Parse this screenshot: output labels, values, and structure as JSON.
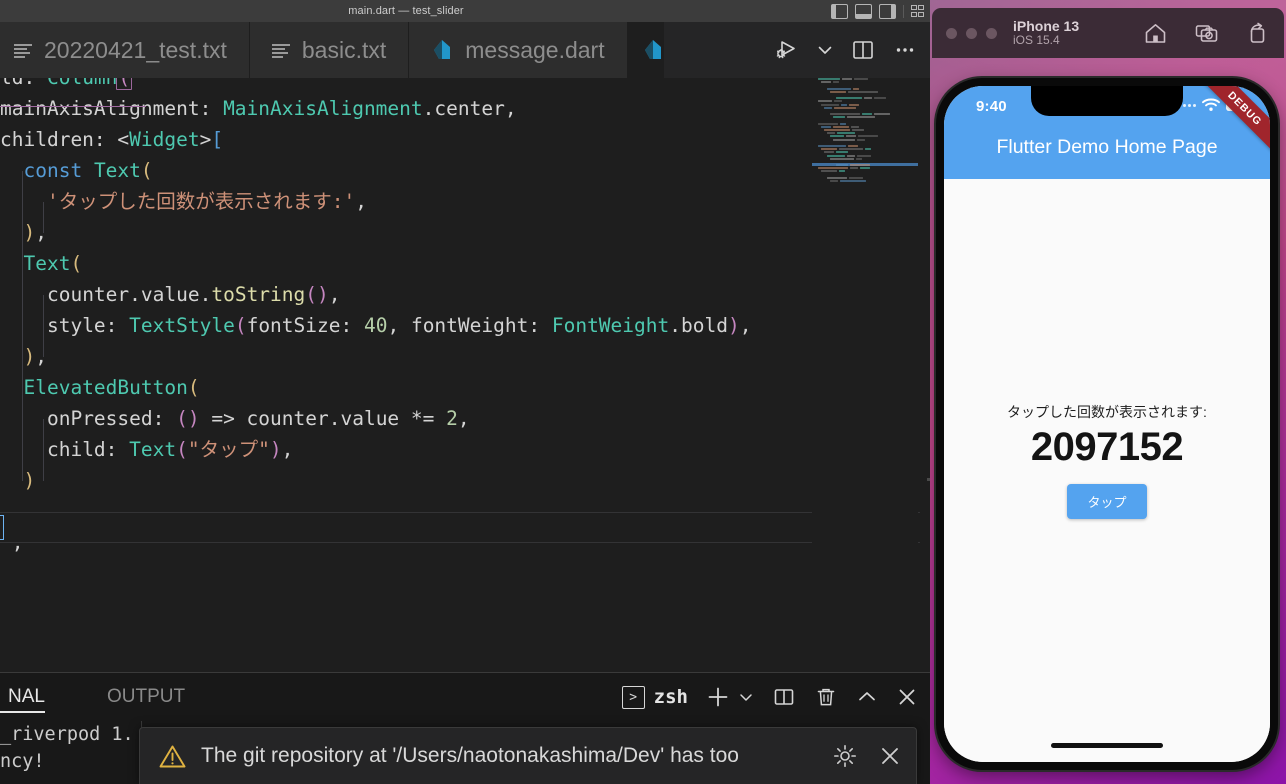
{
  "window": {
    "title": "main.dart — test_slider",
    "layout_icons": [
      "layout-sidebar-left-icon",
      "layout-panel-icon",
      "layout-sidebar-right-icon",
      "layout-grid-icon"
    ]
  },
  "tabs": [
    {
      "label": "20220421_test.txt",
      "icon": "text-file-icon",
      "active": false
    },
    {
      "label": "basic.txt",
      "icon": "text-file-icon",
      "active": false
    },
    {
      "label": "message.dart",
      "icon": "dart-file-icon",
      "active": false
    },
    {
      "label": "",
      "icon": "dart-file-icon",
      "active": true
    }
  ],
  "editor_actions": {
    "run_debug": "run-and-debug-icon",
    "chevron": "chevron-down-icon",
    "split": "split-editor-icon",
    "more": "more-actions-icon"
  },
  "code": {
    "lines": [
      {
        "indent": 0,
        "partial": true,
        "tokens": [
          {
            "t": "ld: ",
            "c": "t-plain"
          },
          {
            "t": "Column",
            "c": "t-type"
          },
          {
            "t": "(",
            "c": "t-br3 bracket-box"
          }
        ]
      },
      {
        "indent": 0,
        "tokens": [
          {
            "t": "mainAxisAlignment: ",
            "c": "t-plain"
          },
          {
            "t": "MainAxisAlignment",
            "c": "t-type"
          },
          {
            "t": ".center,",
            "c": "t-plain"
          }
        ]
      },
      {
        "indent": 0,
        "tokens": [
          {
            "t": "children: <",
            "c": "t-plain"
          },
          {
            "t": "Widget",
            "c": "t-type"
          },
          {
            "t": ">",
            "c": "t-plain"
          },
          {
            "t": "[",
            "c": "t-br1"
          }
        ]
      },
      {
        "indent": 1,
        "tokens": [
          {
            "t": "const ",
            "c": "t-kw"
          },
          {
            "t": "Text",
            "c": "t-type"
          },
          {
            "t": "(",
            "c": "t-br2"
          }
        ]
      },
      {
        "indent": 2,
        "tokens": [
          {
            "t": "'タップした回数が表示されます:'",
            "c": "t-str"
          },
          {
            "t": ",",
            "c": "t-plain"
          }
        ]
      },
      {
        "indent": 1,
        "tokens": [
          {
            "t": ")",
            "c": "t-br2"
          },
          {
            "t": ",",
            "c": "t-plain"
          }
        ]
      },
      {
        "indent": 1,
        "tokens": [
          {
            "t": "Text",
            "c": "t-type"
          },
          {
            "t": "(",
            "c": "t-br2"
          }
        ]
      },
      {
        "indent": 2,
        "tokens": [
          {
            "t": "counter.value.",
            "c": "t-plain"
          },
          {
            "t": "toString",
            "c": "t-fn"
          },
          {
            "t": "()",
            "c": "t-br3"
          },
          {
            "t": ",",
            "c": "t-plain"
          }
        ]
      },
      {
        "indent": 2,
        "tokens": [
          {
            "t": "style: ",
            "c": "t-plain"
          },
          {
            "t": "TextStyle",
            "c": "t-type"
          },
          {
            "t": "(",
            "c": "t-br3"
          },
          {
            "t": "fontSize: ",
            "c": "t-plain"
          },
          {
            "t": "40",
            "c": "t-num"
          },
          {
            "t": ", fontWeight: ",
            "c": "t-plain"
          },
          {
            "t": "FontWeight",
            "c": "t-type"
          },
          {
            "t": ".bold",
            "c": "t-plain"
          },
          {
            "t": ")",
            "c": "t-br3"
          },
          {
            "t": ",",
            "c": "t-plain"
          }
        ]
      },
      {
        "indent": 1,
        "tokens": [
          {
            "t": ")",
            "c": "t-br2"
          },
          {
            "t": ",",
            "c": "t-plain"
          }
        ]
      },
      {
        "indent": 1,
        "tokens": [
          {
            "t": "ElevatedButton",
            "c": "t-type"
          },
          {
            "t": "(",
            "c": "t-br2"
          }
        ]
      },
      {
        "indent": 2,
        "tokens": [
          {
            "t": "onPressed: ",
            "c": "t-plain"
          },
          {
            "t": "()",
            "c": "t-br3"
          },
          {
            "t": " => counter.value *= ",
            "c": "t-plain"
          },
          {
            "t": "2",
            "c": "t-num"
          },
          {
            "t": ",",
            "c": "t-plain"
          }
        ]
      },
      {
        "indent": 2,
        "tokens": [
          {
            "t": "child: ",
            "c": "t-plain"
          },
          {
            "t": "Text",
            "c": "t-type"
          },
          {
            "t": "(",
            "c": "t-br3"
          },
          {
            "t": "\"タップ\"",
            "c": "t-str"
          },
          {
            "t": ")",
            "c": "t-br3"
          },
          {
            "t": ",",
            "c": "t-plain"
          }
        ]
      },
      {
        "indent": 1,
        "tokens": [
          {
            "t": ")",
            "c": "t-br2"
          }
        ]
      },
      {
        "indent": 0,
        "blank": true,
        "tokens": []
      },
      {
        "indent": 0,
        "highlight": true,
        "caret": true,
        "tokens": [
          {
            "t": " ,",
            "c": "t-plain"
          }
        ]
      }
    ]
  },
  "panel": {
    "tabs": [
      {
        "label": "NAL",
        "active": true
      },
      {
        "label": "OUTPUT",
        "active": false
      }
    ],
    "shell": "zsh",
    "shell_icon": "terminal-icon",
    "actions": [
      "new-terminal-icon",
      "chevron-down-icon",
      "split-terminal-icon",
      "kill-terminal-icon",
      "maximize-panel-icon",
      "close-panel-icon"
    ],
    "terminal_lines": [
      "_riverpod 1.",
      "ncy!"
    ]
  },
  "toast": {
    "icon": "warning-icon",
    "message": "The git repository at '/Users/naotonakashima/Dev' has too",
    "gear": "gear-icon",
    "close": "close-icon"
  },
  "simulator": {
    "device": "iPhone 13",
    "os": "iOS 15.4",
    "toolbar_icons": [
      "home-icon",
      "screenshot-icon",
      "rotate-icon"
    ],
    "status_bar": {
      "time": "9:40",
      "signal": "signal-icon",
      "wifi": "wifi-icon",
      "battery": "battery-icon"
    },
    "debug_banner": "DEBUG",
    "app": {
      "title": "Flutter Demo Home Page",
      "counter_label": "タップした回数が表示されます:",
      "counter_value": "2097152",
      "button_label": "タップ"
    }
  },
  "colors": {
    "accent_blue": "#54a3ef",
    "debug_red": "#a0252c",
    "editor_bg": "#1e1e1e",
    "tab_bg": "#2d2d2d",
    "warning_yellow": "#e0b341"
  }
}
